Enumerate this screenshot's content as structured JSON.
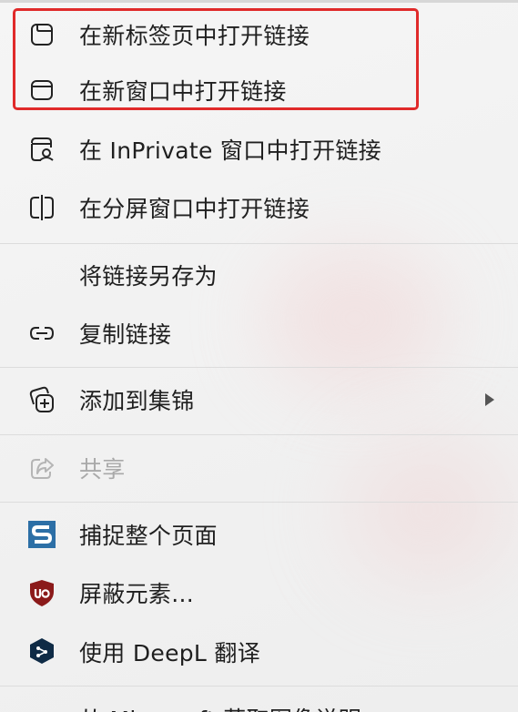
{
  "menu": {
    "items": [
      {
        "label": "在新标签页中打开链接",
        "icon": "new-tab-icon"
      },
      {
        "label": "在新窗口中打开链接",
        "icon": "new-window-icon"
      },
      {
        "label": "在 InPrivate 窗口中打开链接",
        "icon": "inprivate-window-icon"
      },
      {
        "label": "在分屏窗口中打开链接",
        "icon": "split-screen-icon"
      },
      {
        "label": "将链接另存为",
        "icon": ""
      },
      {
        "label": "复制链接",
        "icon": "link-icon"
      },
      {
        "label": "添加到集锦",
        "icon": "collections-add-icon"
      },
      {
        "label": "共享",
        "icon": "share-icon"
      },
      {
        "label": "捕捉整个页面",
        "icon": "capture-page-icon"
      },
      {
        "label": "屏蔽元素...",
        "icon": "ublock-shield-icon"
      },
      {
        "label": "使用 DeepL 翻译",
        "icon": "deepl-icon"
      },
      {
        "label": "从 Microsoft 获取图像说明",
        "icon": ""
      }
    ]
  },
  "colors": {
    "highlight_border": "#e02a2a",
    "disabled_text": "#a9a9a9",
    "ublock_red": "#8b1a1a",
    "capture_blue": "#2c6fa6",
    "deepl_navy": "#0f2b46"
  }
}
